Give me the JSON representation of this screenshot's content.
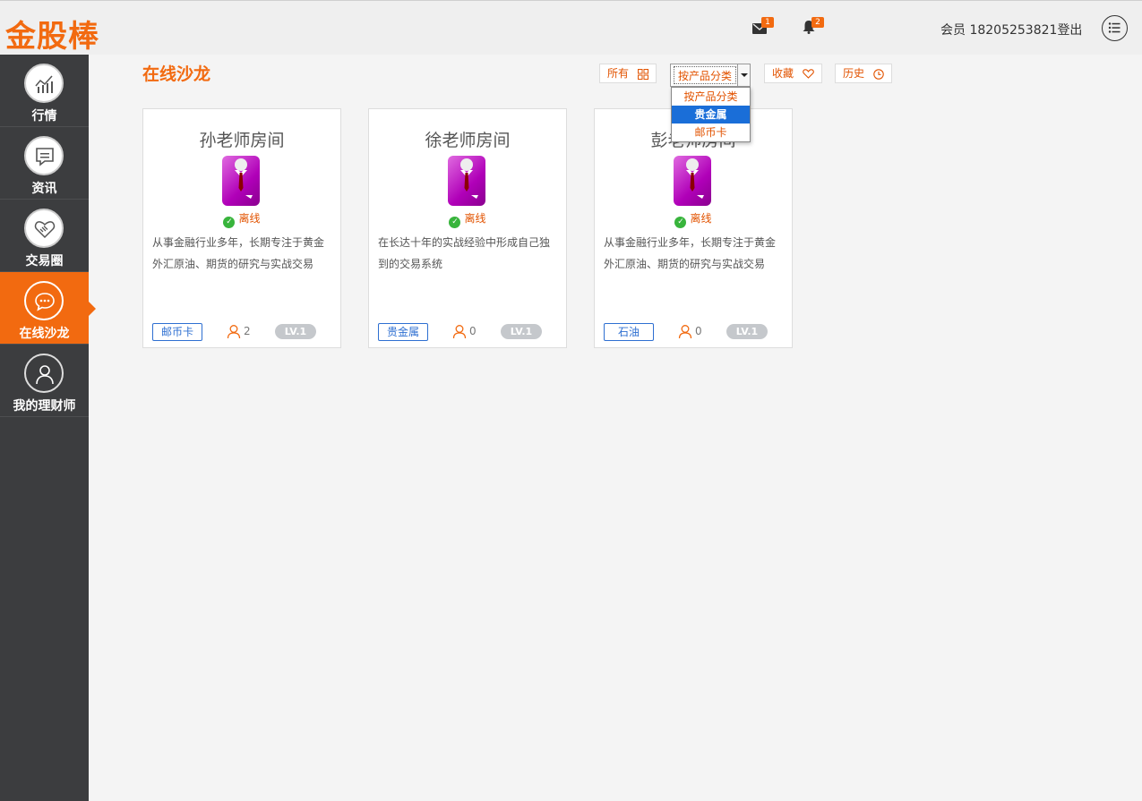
{
  "header": {
    "logo": "金股棒",
    "mail_badge": "1",
    "bell_badge": "2",
    "member_text": "会员 18205253821",
    "logout": "登出"
  },
  "sidebar": {
    "items": [
      {
        "label": "行情",
        "icon": "chart-icon"
      },
      {
        "label": "资讯",
        "icon": "news-icon"
      },
      {
        "label": "交易圈",
        "icon": "handshake-icon"
      },
      {
        "label": "在线沙龙",
        "icon": "chat-icon",
        "active": true
      },
      {
        "label": "我的理财师",
        "icon": "user-icon"
      }
    ]
  },
  "main": {
    "title": "在线沙龙",
    "filters": {
      "all": "所有",
      "category_selected": "按产品分类",
      "favorites": "收藏",
      "history": "历史"
    },
    "dropdown_options": [
      "按产品分类",
      "贵金属",
      "邮币卡"
    ],
    "rooms": [
      {
        "name": "孙老师房间",
        "status": "离线",
        "desc": "从事金融行业多年，长期专注于黄金外汇原油、期货的研究与实战交易",
        "tag": "邮币卡",
        "users": "2",
        "level": "LV.1"
      },
      {
        "name": "徐老师房间",
        "status": "离线",
        "desc": "在长达十年的实战经验中形成自己独到的交易系统",
        "tag": "贵金属",
        "users": "0",
        "level": "LV.1"
      },
      {
        "name": "彭老师房间",
        "status": "离线",
        "desc": "从事金融行业多年，长期专注于黄金外汇原油、期货的研究与实战交易",
        "tag": "石油",
        "users": "0",
        "level": "LV.1"
      }
    ]
  },
  "colors": {
    "accent": "#f26a10",
    "sidebar": "#3c3d3f",
    "tag_blue": "#2e6fd1",
    "online_green": "#38b43c"
  }
}
